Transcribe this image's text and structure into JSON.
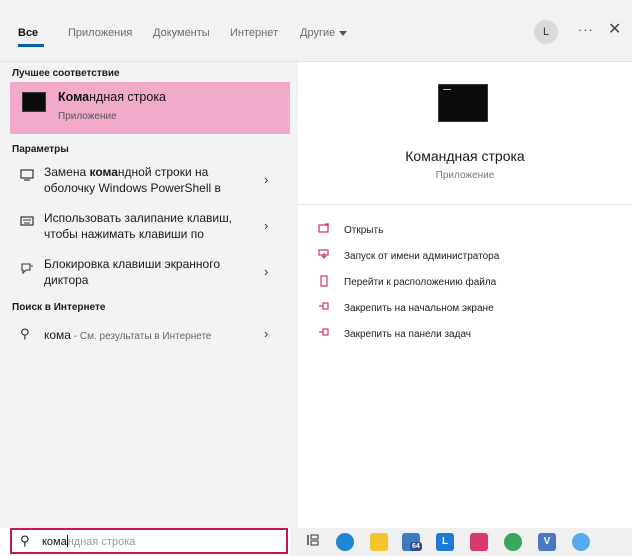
{
  "tabs": [
    {
      "label": "Все",
      "active": true
    },
    {
      "label": "Приложения"
    },
    {
      "label": "Документы"
    },
    {
      "label": "Интернет"
    },
    {
      "label": "Другие"
    }
  ],
  "header": {
    "avatar": "L",
    "more": "···",
    "close": "✕"
  },
  "best_match": {
    "heading": "Лучшее соответствие",
    "title_bold": "Кома",
    "title_rest": "ндная строка",
    "subtitle": "Приложение"
  },
  "settings": {
    "heading": "Параметры",
    "items": [
      {
        "line1_pre": "Замена ",
        "line1_bold": "кома",
        "line1_post": "ндной строки на",
        "line2": "оболочку Windows PowerShell в",
        "icon": "monitor-icon"
      },
      {
        "line1": "Использовать залипание клавиш,",
        "line2": "чтобы нажимать клавиши по",
        "icon": "keyboard-icon"
      },
      {
        "line1": "Блокировка клавиши экранного",
        "line2": "диктора",
        "icon": "narrator-icon"
      }
    ]
  },
  "web": {
    "heading": "Поиск в Интернете",
    "term": "кома",
    "suffix": " - См. результаты в Интернете"
  },
  "detail": {
    "title": "Командная строка",
    "subtitle": "Приложение",
    "actions": [
      {
        "label": "Открыть",
        "icon": "open-icon"
      },
      {
        "label": "Запуск от имени администратора",
        "icon": "admin-shield-icon"
      },
      {
        "label": "Перейти к расположению файла",
        "icon": "file-location-icon"
      },
      {
        "label": "Закрепить на начальном экране",
        "icon": "pin-icon"
      },
      {
        "label": "Закрепить на панели задач",
        "icon": "pin-icon"
      }
    ]
  },
  "search": {
    "typed": "кома",
    "ghost": "ндная строка"
  },
  "taskbar": {
    "icons": [
      "task-view-icon",
      "edge-icon",
      "file-explorer-icon",
      "mail-icon",
      "store-icon",
      "app-icon",
      "chrome-icon",
      "vpn-icon",
      "browser-icon"
    ],
    "badge": "64",
    "l_label": "L",
    "v_label": "V"
  },
  "colors": {
    "accent": "#f2aacb",
    "search_border": "#c2185b",
    "action_icon": "#d0316b"
  }
}
